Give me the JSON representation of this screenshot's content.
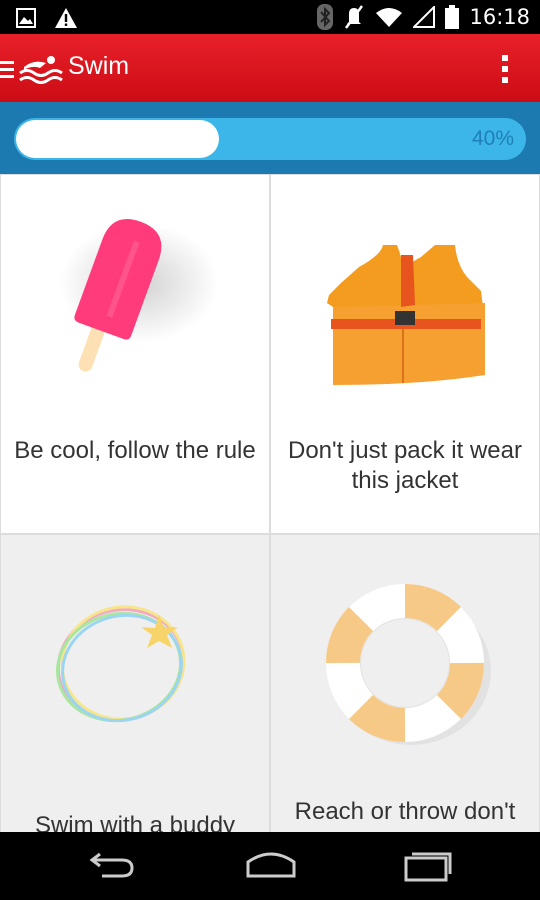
{
  "status_bar": {
    "time": "16:18",
    "left_icons": [
      "image-icon",
      "warning-icon"
    ],
    "right_icons": [
      "bluetooth-icon",
      "mute-icon",
      "wifi-icon",
      "signal-icon",
      "battery-icon"
    ]
  },
  "app_bar": {
    "title": "Swim",
    "icons": [
      "menu-icon",
      "swimmer-logo-icon",
      "overflow-menu-icon"
    ],
    "color": "#e0161f"
  },
  "progress": {
    "value": 0.4,
    "label": "40%",
    "track_color": "#3cb6e8",
    "fill_color": "#ffffff"
  },
  "cards": [
    {
      "label": "Be cool, follow the rule",
      "icon": "popsicle-icon"
    },
    {
      "label": "Don't just pack it wear this jacket",
      "icon": "life-jacket-icon"
    },
    {
      "label": "Swim with a buddy",
      "icon": "glowstick-star-icon"
    },
    {
      "label": "Reach or throw don't",
      "icon": "lifebuoy-icon"
    }
  ],
  "nav_bar": {
    "icons": [
      "back-icon",
      "home-icon",
      "recents-icon"
    ]
  }
}
